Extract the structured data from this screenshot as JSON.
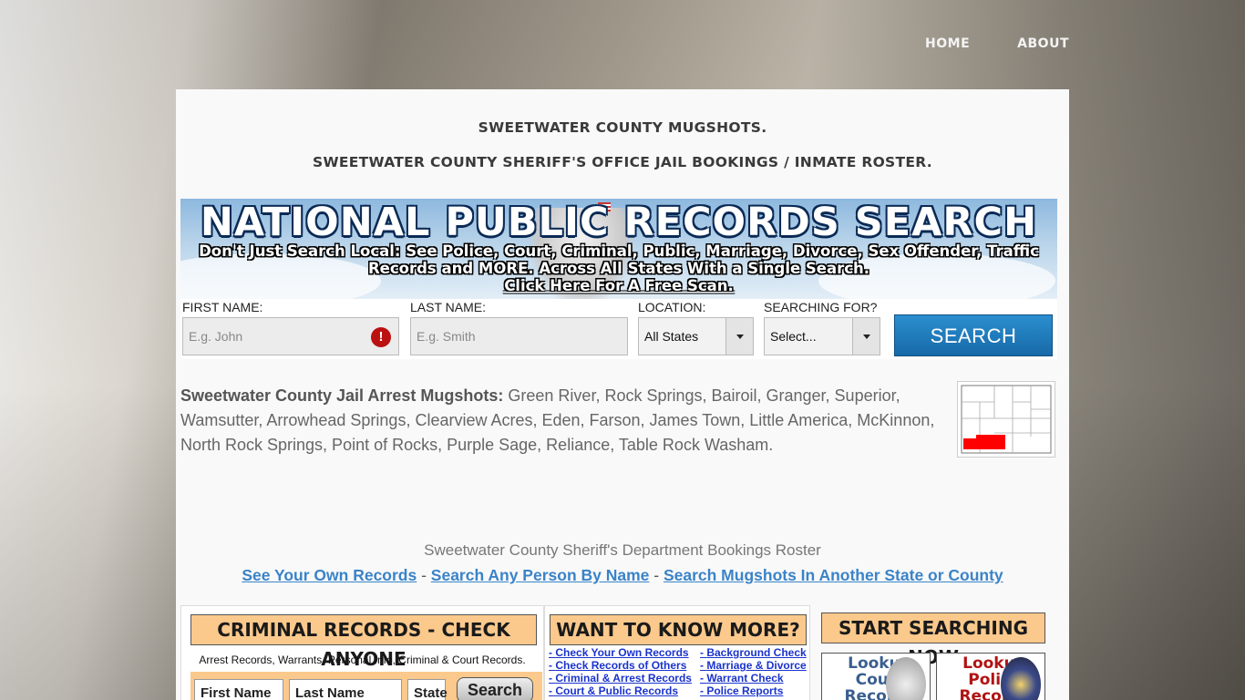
{
  "nav": {
    "home": "HOME",
    "about": "ABOUT"
  },
  "page": {
    "title": "SWEETWATER COUNTY MUGSHOTS.",
    "subtitle": "SWEETWATER COUNTY SHERIFF'S OFFICE JAIL BOOKINGS / INMATE ROSTER."
  },
  "banner": {
    "title": "NATIONAL PUBLIC RECORDS SEARCH",
    "subtitle": "Don't Just Search Local: See Police, Court, Criminal, Public, Marriage, Divorce, Sex Offender, Traffic Records and MORE. Across All States With a Single Search.",
    "cta": "Click Here For A Free Scan."
  },
  "search_form": {
    "first_name_label": "FIRST NAME:",
    "first_name_placeholder": "E.g. John",
    "last_name_label": "LAST NAME:",
    "last_name_placeholder": "E.g. Smith",
    "location_label": "LOCATION:",
    "location_value": "All States",
    "searching_for_label": "SEARCHING FOR?",
    "searching_for_value": "Select...",
    "button": "SEARCH"
  },
  "description": {
    "lead": "Sweetwater County Jail Arrest Mugshots:",
    "text": " Green River, Rock Springs, Bairoil, Granger, Superior, Wamsutter, Arrowhead Springs, Clearview Acres, Eden, Farson, James Town, Little America, McKinnon, North Rock Springs, Point of Rocks, Purple Sage, Reliance, Table Rock Washam."
  },
  "roster": {
    "text": "Sweetwater County Sheriff's Department Bookings Roster",
    "links": [
      "See Your Own Records",
      "Search Any Person By Name",
      "Search Mugshots In Another State or County"
    ],
    "separator": " - "
  },
  "ads": {
    "criminal": {
      "heading": "CRIMINAL RECORDS - CHECK ANYONE",
      "sub": "Arrest Records, Warrants, Personal Info, Criminal & Court Records.",
      "first": "First Name",
      "last": "Last Name",
      "state": "State",
      "button": "Search"
    },
    "more": {
      "heading": "WANT TO KNOW MORE?",
      "left_links": [
        "Check Your Own Records",
        "Check Records of Others",
        "Criminal & Arrest Records",
        "Court & Public Records"
      ],
      "right_links": [
        "Background Check",
        "Marriage & Divorce",
        "Warrant Check",
        "Police Reports"
      ],
      "bullet": "-"
    },
    "start": {
      "heading": "START SEARCHING NOW",
      "tile1": "Lookup Court Records",
      "tile2": "Lookup Police Records"
    }
  },
  "colors": {
    "accent_blue": "#3a83c8",
    "ad_orange": "#fbc98c",
    "map_highlight": "#ff0000"
  }
}
